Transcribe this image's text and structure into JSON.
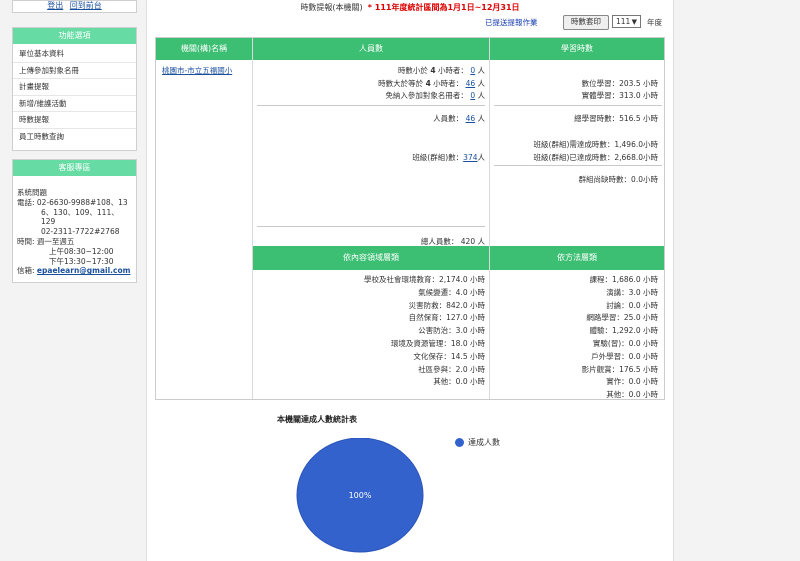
{
  "sidebar": {
    "logout": "登出",
    "back_to_front": "回到前台",
    "menu_title": "功能選項",
    "menu_items": [
      "單位基本資料",
      "上傳參加對象名冊",
      "計畫提報",
      "新增/維護活動",
      "時數提報",
      "員工時數查詢"
    ],
    "service_title": "客服專區",
    "service": {
      "line1": "系統問題",
      "line2": "電話: 02-6630-9988#108、13",
      "line3": "6、130、109、111、129",
      "line4": "02-2311-7722#2768",
      "line5": "時間: 週一至週五",
      "line6": "上午08:30~12:00",
      "line7": "下午13:30~17:30",
      "email_label": "信箱:",
      "email": "epaelearn@gmail.com"
    }
  },
  "header": {
    "title": "時數提報(本機關)",
    "note": "* 111年度統計區間為1月1日~12月31日",
    "sent_link": "已提送提報作業",
    "print_button": "時數套印",
    "year_value": "111",
    "year_label": "年度"
  },
  "table": {
    "headers": {
      "org": "機關(構)名稱",
      "people": "人員數",
      "hours": "學習時數"
    },
    "org_name": "桃園市-市立五福國小",
    "people": {
      "under4_label": "時數小於",
      "under4_num": "4",
      "under4_suffix": "小時者：",
      "under4_value": "0",
      "unit": "人",
      "over4_label": "時數大於等於",
      "over4_num": "4",
      "over4_suffix": "小時者：",
      "over4_value": "46",
      "exempt_label": "免納入參加對象名冊者：",
      "exempt_value": "0",
      "staff_label": "人員數：",
      "staff_value": "46",
      "class_label": "班級(群組)數：",
      "class_value": "374",
      "total_label": "總人員數：",
      "total_value": "420"
    },
    "hours": {
      "digital": "數位學習：203.5 小時",
      "physical": "實體學習：313.0 小時",
      "total": "總學習時數：516.5 小時",
      "class_required": "班級(群組)需達成時數：1,496.0小時",
      "class_reached": "班級(群組)已達成時數：2,668.0小時",
      "class_missing": "群組尚缺時數：0.0小時"
    },
    "by_domain_header": "依內容領域層類",
    "by_method_header": "依方法層類",
    "by_domain": [
      "學校及社會環境教育：2,174.0 小時",
      "氣候變遷：4.0 小時",
      "災害防救：842.0 小時",
      "自然保育：127.0 小時",
      "公害防治：3.0 小時",
      "環境及資源管理：18.0 小時",
      "文化保存：14.5 小時",
      "社區參與：2.0 小時",
      "其他：0.0 小時"
    ],
    "by_method": [
      "課程：1,686.0 小時",
      "演講：3.0 小時",
      "討論：0.0 小時",
      "網路學習：25.0 小時",
      "體驗：1,292.0 小時",
      "實驗(習)：0.0 小時",
      "戶外學習：0.0 小時",
      "影片觀賞：176.5 小時",
      "實作：0.0 小時",
      "其他：0.0 小時"
    ]
  },
  "chart": {
    "title": "本機關達成人數統計表",
    "legend": "達成人數",
    "color": "#3362cc",
    "slice_label": "100%"
  },
  "chart_data": {
    "type": "pie",
    "title": "本機關達成人數統計表",
    "labels": [
      "達成人數"
    ],
    "values": [
      100
    ],
    "legend_position": "top-right"
  }
}
